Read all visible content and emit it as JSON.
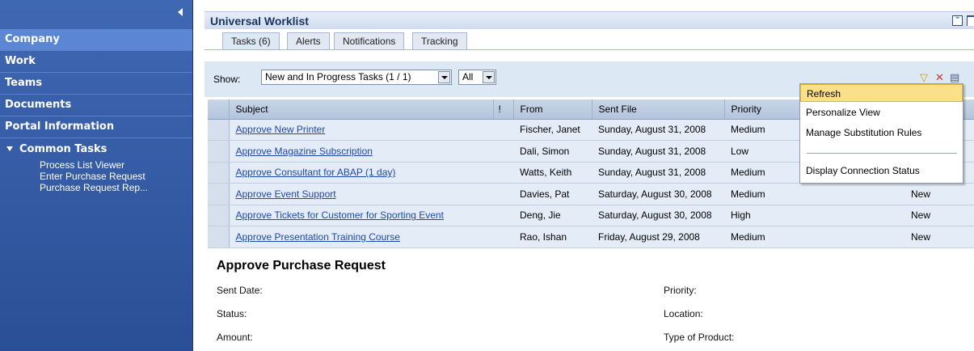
{
  "sidebar": {
    "items": [
      {
        "label": "Company",
        "selected": true
      },
      {
        "label": "Work",
        "selected": false
      },
      {
        "label": "Teams",
        "selected": false
      },
      {
        "label": "Documents",
        "selected": false
      },
      {
        "label": "Portal Information",
        "selected": false
      }
    ],
    "common_tasks": {
      "heading": "Common Tasks",
      "links": [
        "Process List Viewer",
        "Enter Purchase Request",
        "Purchase Request Rep..."
      ]
    }
  },
  "worklist": {
    "title": "Universal Worklist",
    "tabs": [
      {
        "label": "Tasks (6)",
        "active": true
      },
      {
        "label": "Alerts",
        "active": false
      },
      {
        "label": "Notifications",
        "active": false
      },
      {
        "label": "Tracking",
        "active": false
      }
    ],
    "show_label": "Show:",
    "filter_select": "New and In Progress Tasks (1 / 1)",
    "scope_select": "All",
    "icons": [
      "filter-icon",
      "clear-filter-icon",
      "settings-icon"
    ]
  },
  "table": {
    "columns": [
      "Subject",
      "!",
      "From",
      "Sent File",
      "Priority"
    ],
    "rows": [
      {
        "subject": "Approve New Printer",
        "from": "Fischer, Janet",
        "sent": "Sunday, August 31, 2008",
        "priority": "Medium",
        "status": ""
      },
      {
        "subject": "Approve Magazine Subscription",
        "from": "Dali, Simon",
        "sent": "Sunday, August 31, 2008",
        "priority": "Low",
        "status": ""
      },
      {
        "subject": "Approve Consultant for ABAP (1 day)",
        "from": "Watts, Keith",
        "sent": "Sunday, August 31, 2008",
        "priority": "Medium",
        "status": ""
      },
      {
        "subject": "Approve Event Support",
        "from": "Davies, Pat",
        "sent": "Saturday, August 30, 2008",
        "priority": "Medium",
        "status": "New"
      },
      {
        "subject": "Approve Tickets for Customer for Sporting Event",
        "from": "Deng, Jie",
        "sent": "Saturday, August 30, 2008",
        "priority": "High",
        "status": "New"
      },
      {
        "subject": "Approve Presentation Training Course",
        "from": "Rao, Ishan",
        "sent": "Friday, August 29, 2008",
        "priority": "Medium",
        "status": "New"
      }
    ]
  },
  "detail": {
    "title": "Approve Purchase Request",
    "left_labels": [
      "Sent Date:",
      "Status:",
      "Amount:"
    ],
    "right_labels": [
      "Priority:",
      "Location:",
      "Type of Product:"
    ]
  },
  "context_menu": {
    "items": [
      {
        "label": "Refresh",
        "hover": true
      },
      {
        "label": "Personalize View",
        "hover": false
      },
      {
        "label": "Manage Substitution Rules",
        "hover": false
      },
      {
        "label": "Display Connection Status",
        "hover": false
      }
    ]
  },
  "colors": {
    "sidebar_bg": "#3f68b3",
    "title_text": "#18345f",
    "link": "#1f48a8",
    "row_bg": "#e4ecf7",
    "menu_hover": "#fbe08a"
  }
}
